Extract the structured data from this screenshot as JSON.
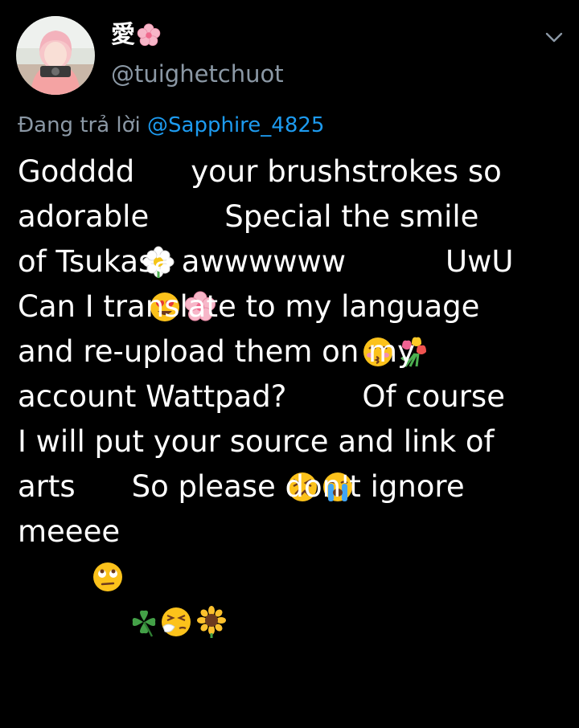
{
  "author": {
    "display_name": "愛",
    "display_name_emoji": "cherry-blossom-icon",
    "handle": "@tuighetchuot"
  },
  "reply": {
    "prefix": "Đang trả lời ",
    "mention": "@Sapphire_4825"
  },
  "tweet": {
    "l1a": "Godddd",
    "l1b": "your brushstrokes so",
    "l2a": "adorable",
    "l2b": "Special the smile",
    "l3a": "of Tsukasa awwwwww",
    "l3b": "UwU",
    "l4": "Can I translate to my language",
    "l5": "and re-upload them on my",
    "l6a": "account Wattpad?",
    "l6b": "Of course",
    "l7": "I will put your source and link of",
    "l8a": "arts",
    "l8b": "So please don't ignore",
    "l9a": "meeee"
  },
  "emojis": [
    "blossom-icon",
    "heart-eyes-icon",
    "cherry-blossom-icon",
    "kissing-closed-eyes-icon",
    "tulip-bouquet-icon",
    "confounded-face-icon",
    "loudly-crying-face-icon",
    "rolling-eyes-face-icon",
    "four-leaf-clover-icon",
    "sneezing-face-icon",
    "sunflower-icon"
  ],
  "colors": {
    "background": "#000000",
    "text": "#ffffff",
    "secondary_text": "#8b98a5",
    "link": "#1d9bf0"
  }
}
